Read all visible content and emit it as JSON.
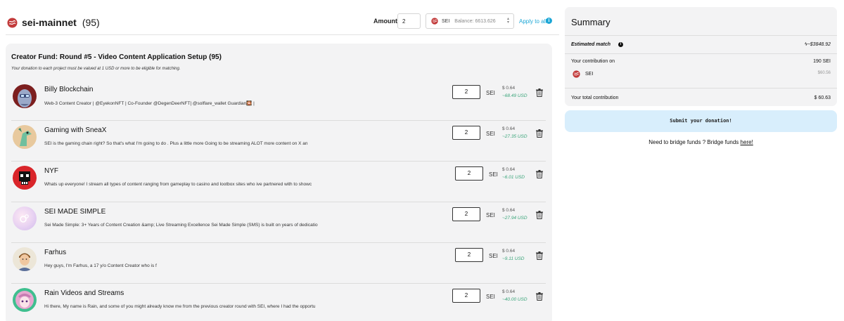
{
  "header": {
    "chain_name": "sei-mainnet",
    "chain_count": "(95)",
    "amount_label": "Amount",
    "amount_value": "2",
    "token_name": "SEI",
    "balance_text": "Balance: 6613.626",
    "apply_all_label": "Apply to all",
    "info_icon": "i"
  },
  "round": {
    "title": "Creator Fund: Round #5 - Video Content Application Setup",
    "count": "(95)",
    "note": "Your donation to each project must be valued at 1 USD or more to be eligible for matching."
  },
  "projects": [
    {
      "name": "Billy Blockchain",
      "description": "Web-3 Content Creator | @EyekonNFT | Co-Founder @DegenDeerNFT| @solflare_wallet Guardian🎇 |",
      "amount": "2",
      "currency": "SEI",
      "price": "$ 0.64",
      "usd": "~68.49 USD",
      "avatar": "robot-avatar"
    },
    {
      "name": "Gaming with SneaX",
      "description": "SEI is the gaming chain right? So that's what I'm going to do . Plus a little more Going to be streaming ALOT more content on X an",
      "amount": "2",
      "currency": "SEI",
      "price": "$ 0.64",
      "usd": "~27.35 USD",
      "avatar": "dragon-avatar"
    },
    {
      "name": "NYF",
      "description": "Whats up everyone! I stream all types of content ranging from gameplay to casino and lootbox sites who ive partnered with to showc",
      "amount": "2",
      "currency": "SEI",
      "price": "$ 0.64",
      "usd": "~6.01 USD",
      "avatar": "pixel-skull-avatar"
    },
    {
      "name": "SEI MADE SIMPLE",
      "description": "Sei Made Simple: 3+ Years of Content Creation &amp; Live Streaming Excellence Sei Made Simple (SMS) is built on years of dedicatio",
      "amount": "2",
      "currency": "SEI",
      "price": "$ 0.64",
      "usd": "~27.94 USD",
      "avatar": "gradient-avatar"
    },
    {
      "name": "Farhus",
      "description": "Hey guys, I'm Farhus, a 17 y/o Content Creator who is f",
      "amount": "2",
      "currency": "SEI",
      "price": "$ 0.64",
      "usd": "~9.11 USD",
      "avatar": "person-avatar"
    },
    {
      "name": "Rain Videos and Streams",
      "description": "Hi there, My name is Rain, and some of you might already know me from the previous creator round with SEI, where I had the opportu",
      "amount": "2",
      "currency": "SEI",
      "price": "$ 0.64",
      "usd": "~40.00 USD",
      "avatar": "anime-avatar"
    }
  ],
  "summary": {
    "title": "Summary",
    "estimated_label": "Estimated match",
    "estimated_value": "~$3848.92",
    "contribution_label": "Your contribution on",
    "contribution_value": "190  SEI",
    "token_label": "SEI",
    "token_usd": "$60.56",
    "total_label": "Your total contribution",
    "total_value": "$ 60.63",
    "submit_label": "Submit your donation!",
    "bridge_text": "Need to bridge funds ? Bridge funds",
    "bridge_link": "here!"
  },
  "colors": {
    "accent": "#1ea7d6",
    "usd_green": "#3aa57a",
    "panel_bg": "#f3f3f4",
    "submit_bg": "#d8eefc",
    "sei_red": "#c23a3a"
  }
}
